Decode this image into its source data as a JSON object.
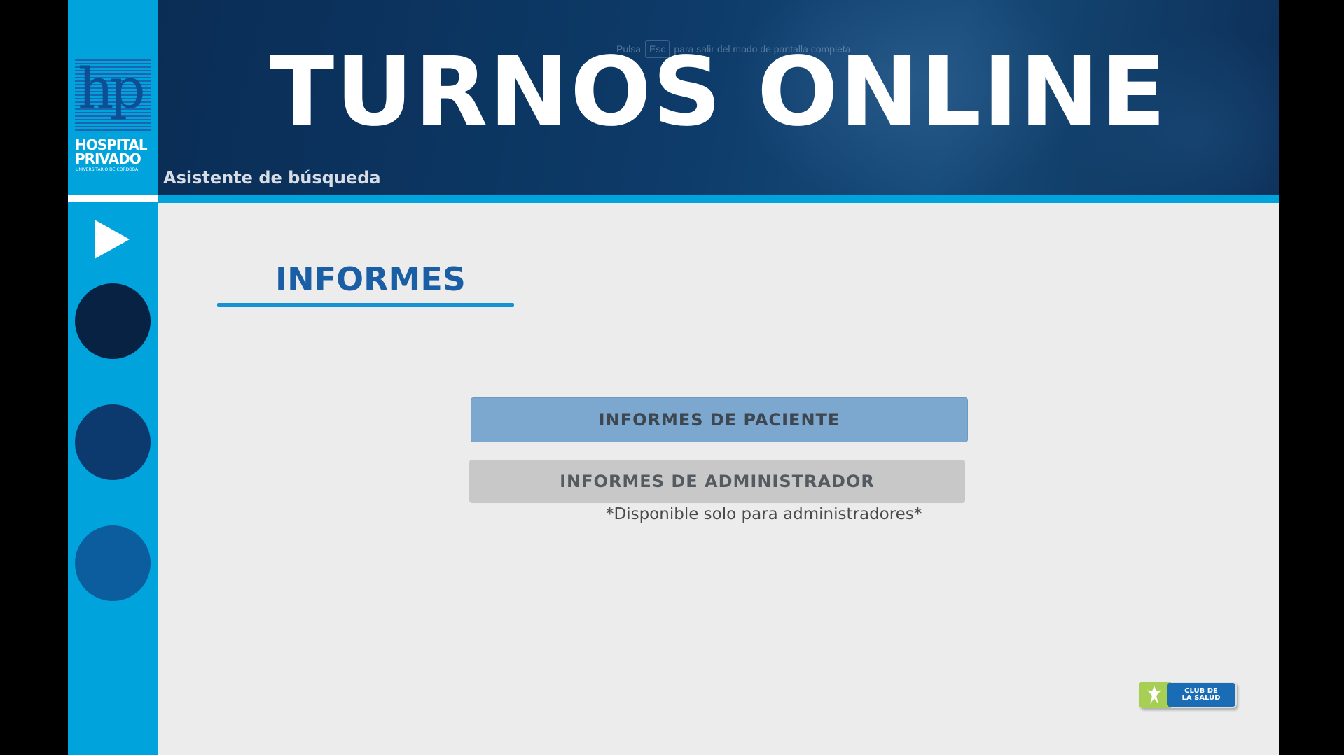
{
  "header": {
    "title": "TURNOS ONLINE",
    "subtitle": "Asistente de búsqueda",
    "fullscreen_hint": {
      "before": "Pulsa",
      "key": "Esc",
      "after": "para salir del modo de pantalla completa"
    }
  },
  "logo": {
    "line1": "HOSPITAL",
    "line2": "PRIVADO",
    "line3": "UNIVERSITARIO DE CÓRDOBA",
    "mark": "hp"
  },
  "sidebar": {
    "items": [
      {
        "icon": "play-icon",
        "color": "#ffffff"
      },
      {
        "icon": "circle-step-1",
        "color": "#082244"
      },
      {
        "icon": "circle-step-2",
        "color": "#0c3a6e"
      },
      {
        "icon": "circle-step-3",
        "color": "#0c5d9e"
      }
    ]
  },
  "content": {
    "section_title": "INFORMES",
    "buttons": {
      "paciente": "INFORMES DE PACIENTE",
      "admin": "INFORMES DE ADMINISTRADOR"
    },
    "admin_note": "*Disponible solo para administradores*"
  },
  "badge": {
    "line1": "CLUB DE",
    "line2": "LA SALUD"
  },
  "colors": {
    "accent_blue": "#00a3dc",
    "header_navy": "#0d3a68",
    "title_blue": "#1a5fa5",
    "button_blue": "#7ca8d0",
    "button_gray": "#c8c8c8"
  }
}
